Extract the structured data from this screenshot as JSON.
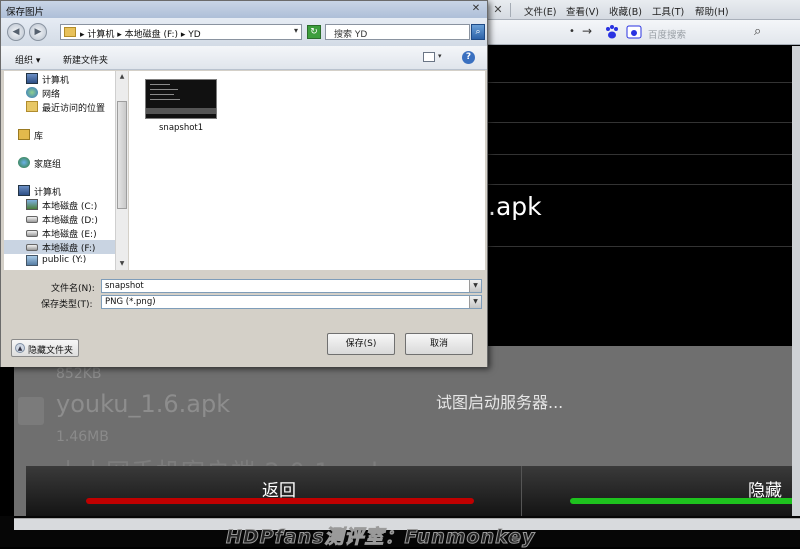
{
  "browser": {
    "menus": [
      "文件(E)",
      "查看(V)",
      "收藏(B)",
      "工具(T)",
      "帮助(H)"
    ],
    "search_placeholder": "百度搜索"
  },
  "app": {
    "apk_title_suffix": ".apk",
    "file_size_1": "852KB",
    "file_name_2": "youku_1.6.apk",
    "file_size_2": "1.46MB",
    "ghost_text": "小小网手机客户端 2.0.1.apk",
    "status": "试图启动服务器...",
    "back_label": "返回",
    "hide_label": "隐藏",
    "watermark": "HDPfans测评室：Funmonkey"
  },
  "dialog": {
    "title": "保存图片",
    "path": "▸ 计算机 ▸ 本地磁盘 (F:) ▸ YD",
    "search_placeholder": "搜索 YD",
    "organize": "组织 ▾",
    "new_folder": "新建文件夹",
    "nav_items": [
      {
        "label": "计算机",
        "icon": "computer-icon"
      },
      {
        "label": "网络",
        "icon": "network-icon"
      },
      {
        "label": "最近访问的位置",
        "icon": "recent-places-icon"
      },
      {
        "label": "库",
        "icon": "library-icon"
      },
      {
        "label": "家庭组",
        "icon": "homegroup-icon"
      },
      {
        "label": "计算机",
        "icon": "computer-icon"
      },
      {
        "label": "本地磁盘 (C:)",
        "icon": "drive-icon"
      },
      {
        "label": "本地磁盘 (D:)",
        "icon": "drive-icon"
      },
      {
        "label": "本地磁盘 (E:)",
        "icon": "drive-icon"
      },
      {
        "label": "本地磁盘 (F:)",
        "icon": "drive-icon"
      },
      {
        "label": "public (Y:)",
        "icon": "network-drive-icon"
      }
    ],
    "file_item": "snapshot1",
    "filename_label": "文件名(N):",
    "filename_value": "snapshot",
    "filetype_label": "保存类型(T):",
    "filetype_value": "PNG (*.png)",
    "hide_folders": "隐藏文件夹",
    "save": "保存(S)",
    "cancel": "取消"
  }
}
